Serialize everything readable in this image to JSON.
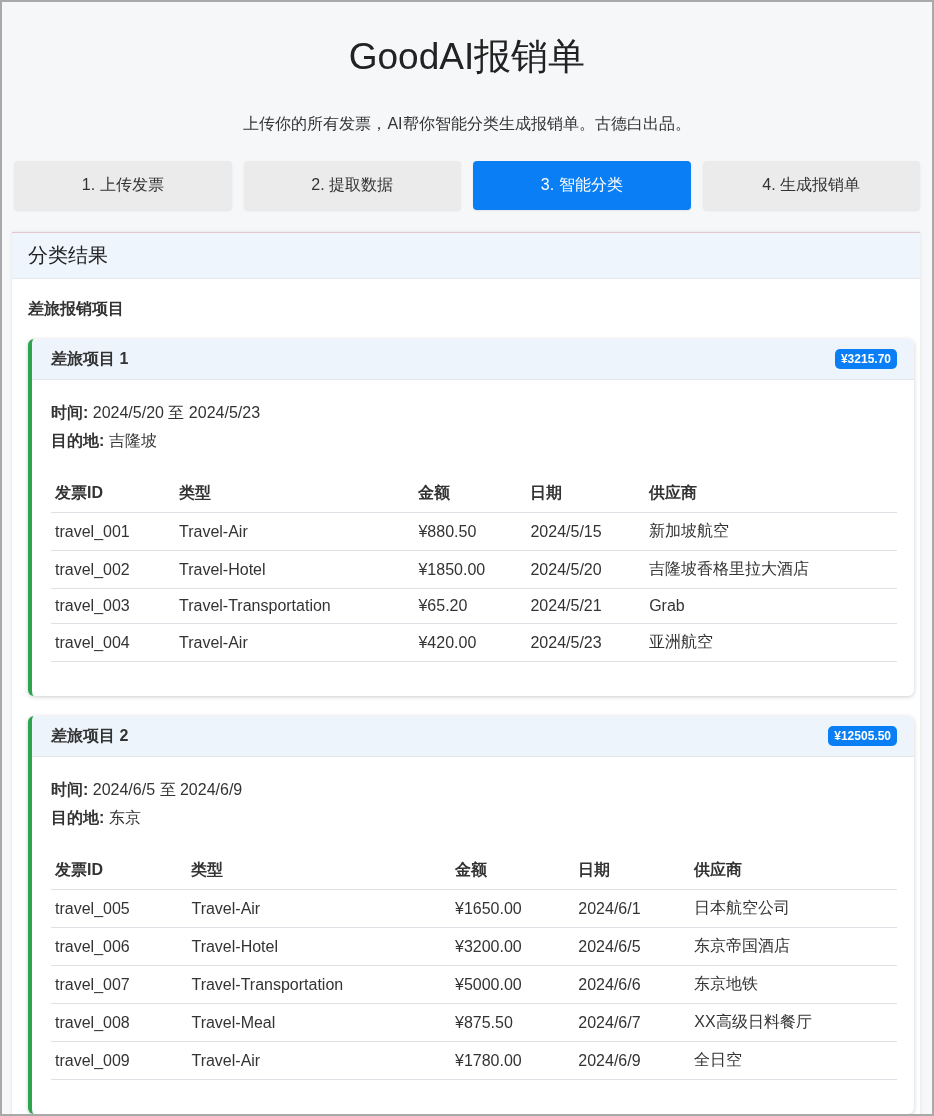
{
  "header": {
    "title": "GoodAI报销单",
    "subtitle": "上传你的所有发票，AI帮你智能分类生成报销单。古德白出品。"
  },
  "tabs": [
    {
      "label": "1. 上传发票",
      "selected": false
    },
    {
      "label": "2. 提取数据",
      "selected": false
    },
    {
      "label": "3. 智能分类",
      "selected": true
    },
    {
      "label": "4. 生成报销单",
      "selected": false
    }
  ],
  "panel": {
    "title": "分类结果",
    "section_title": "差旅报销项目",
    "trips": [
      {
        "title": "差旅项目 1",
        "total": "¥3215.70",
        "time": "**时间:** 2024/5/20 至 2024/5/23",
        "destination": "**目的地:** 吉隆坡",
        "columns": [
          "发票ID",
          "类型",
          "金额",
          "日期",
          "供应商"
        ],
        "rows": [
          [
            "travel_001",
            "Travel-Air",
            "¥880.50",
            "2024/5/15",
            "新加坡航空"
          ],
          [
            "travel_002",
            "Travel-Hotel",
            "¥1850.00",
            "2024/5/20",
            "吉隆坡香格里拉大酒店"
          ],
          [
            "travel_003",
            "Travel-Transportation",
            "¥65.20",
            "2024/5/21",
            "Grab"
          ],
          [
            "travel_004",
            "Travel-Air",
            "¥420.00",
            "2024/5/23",
            "亚洲航空"
          ]
        ]
      },
      {
        "title": "差旅项目 2",
        "total": "¥12505.50",
        "time": "**时间:** 2024/6/5 至 2024/6/9",
        "destination": "**目的地:** 东京",
        "columns": [
          "发票ID",
          "类型",
          "金额",
          "日期",
          "供应商"
        ],
        "rows": [
          [
            "travel_005",
            "Travel-Air",
            "¥1650.00",
            "2024/6/1",
            "日本航空公司"
          ],
          [
            "travel_006",
            "Travel-Hotel",
            "¥3200.00",
            "2024/6/5",
            "东京帝国酒店"
          ],
          [
            "travel_007",
            "Travel-Transportation",
            "¥5000.00",
            "2024/6/6",
            "东京地铁"
          ],
          [
            "travel_008",
            "Travel-Meal",
            "¥875.50",
            "2024/6/7",
            "XX高级日料餐厅"
          ],
          [
            "travel_009",
            "Travel-Air",
            "¥1780.00",
            "2024/6/9",
            "全日空"
          ]
        ]
      }
    ]
  }
}
